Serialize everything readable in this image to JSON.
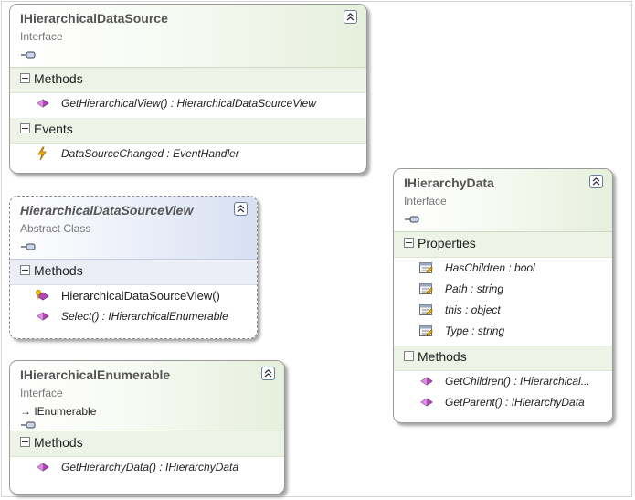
{
  "boxes": {
    "datasource": {
      "title": "IHierarchicalDataSource",
      "stereotype": "Interface",
      "sections": {
        "methods": {
          "label": "Methods",
          "items": [
            "GetHierarchicalView()  :  HierarchicalDataSourceView"
          ]
        },
        "events": {
          "label": "Events",
          "items": [
            "DataSourceChanged : EventHandler"
          ]
        }
      }
    },
    "view": {
      "title": "HierarchicalDataSourceView",
      "stereotype": "Abstract Class",
      "sections": {
        "methods": {
          "label": "Methods",
          "items": [
            "HierarchicalDataSourceView()",
            "Select() : IHierarchicalEnumerable"
          ]
        }
      }
    },
    "enumerable": {
      "title": "IHierarchicalEnumerable",
      "stereotype": "Interface",
      "inherits": "IEnumerable",
      "sections": {
        "methods": {
          "label": "Methods",
          "items": [
            "GetHierarchyData() : IHierarchyData"
          ]
        }
      }
    },
    "hierarchydata": {
      "title": "IHierarchyData",
      "stereotype": "Interface",
      "sections": {
        "properties": {
          "label": "Properties",
          "items": [
            "HasChildren : bool",
            "Path : string",
            "this : object",
            "Type : string"
          ]
        },
        "methods": {
          "label": "Methods",
          "items": [
            "GetChildren()  :  IHierarchical...",
            "GetParent() : IHierarchyData"
          ]
        }
      }
    }
  },
  "icons": {
    "method": "method-icon",
    "event": "event-icon",
    "property": "property-icon",
    "constructor": "constructor-icon",
    "lollipop": "interface-lollipop-icon",
    "collapse": "collapse-chevron-icon"
  },
  "colors": {
    "interface_header": "#e6efdc",
    "abstract_header": "#d7dff1",
    "method_icon": "#b347b8",
    "event_icon": "#e8a000"
  }
}
